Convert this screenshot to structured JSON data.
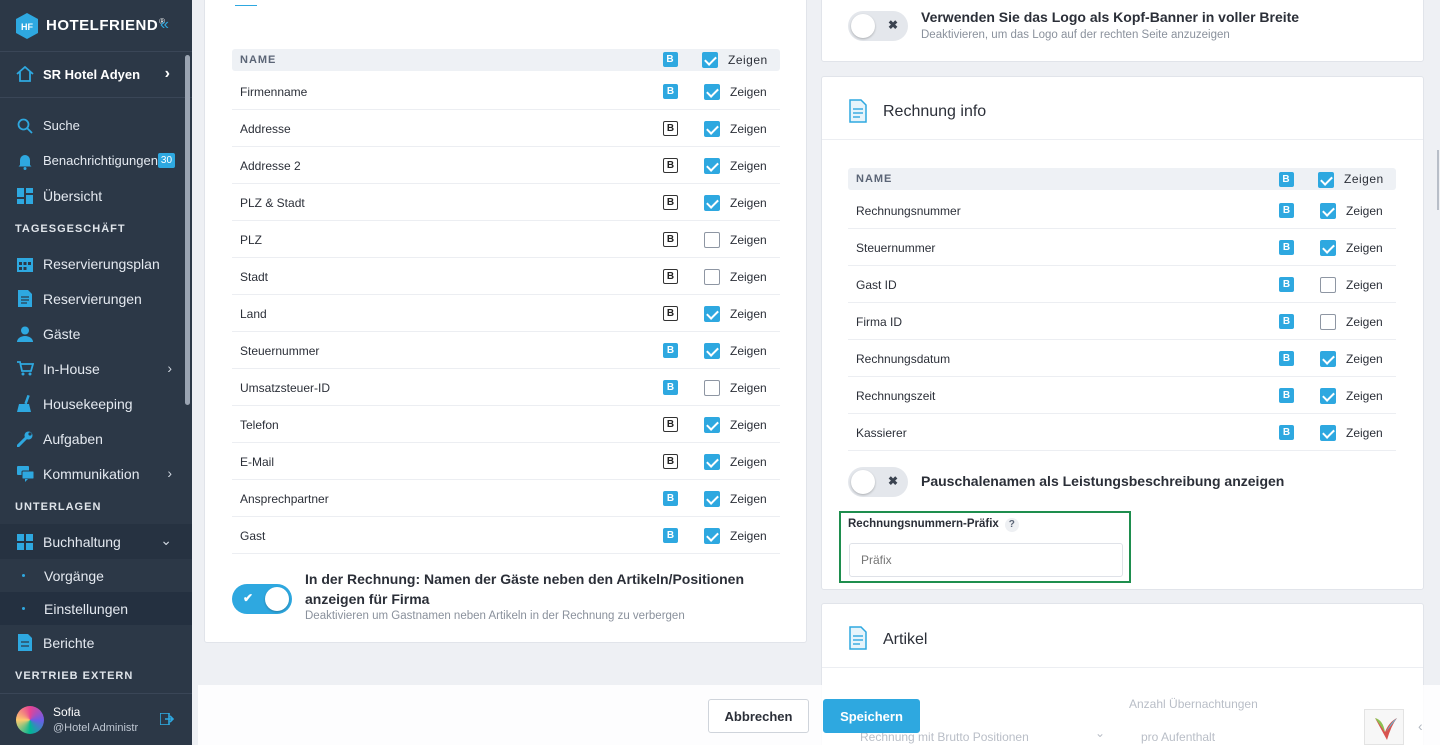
{
  "sidebar": {
    "brand": "HOTELFRIEND",
    "brand_mark": "®",
    "collapse_icon": "«",
    "hotel": "SR Hotel Adyen",
    "search": "Suche",
    "notifications": "Benachrichtigungen",
    "notifications_count": "30",
    "overview": "Übersicht",
    "section_daily": "TAGESGESCHÄFT",
    "reservation_plan": "Reservierungsplan",
    "reservations": "Reservierungen",
    "guests": "Gäste",
    "in_house": "In-House",
    "housekeeping": "Housekeeping",
    "tasks": "Aufgaben",
    "communication": "Kommunikation",
    "section_docs": "UNTERLAGEN",
    "accounting": "Buchhaltung",
    "transactions": "Vorgänge",
    "settings": "Einstellungen",
    "reports": "Berichte",
    "section_sales": "VERTRIEB EXTERN",
    "user_name": "Sofia",
    "user_role": "@Hotel Administr"
  },
  "company": {
    "header_name": "NAME",
    "header_show": "Zeigen",
    "bold_letter": "B",
    "rows": [
      {
        "label": "Firmenname",
        "bold": true,
        "show": true,
        "show_label": "Zeigen"
      },
      {
        "label": "Addresse",
        "bold": false,
        "show": true,
        "show_label": "Zeigen"
      },
      {
        "label": "Addresse 2",
        "bold": false,
        "show": true,
        "show_label": "Zeigen"
      },
      {
        "label": "PLZ & Stadt",
        "bold": false,
        "show": true,
        "show_label": "Zeigen"
      },
      {
        "label": "PLZ",
        "bold": false,
        "show": false,
        "show_label": "Zeigen"
      },
      {
        "label": "Stadt",
        "bold": false,
        "show": false,
        "show_label": "Zeigen"
      },
      {
        "label": "Land",
        "bold": false,
        "show": true,
        "show_label": "Zeigen"
      },
      {
        "label": "Steuernummer",
        "bold": true,
        "show": true,
        "show_label": "Zeigen"
      },
      {
        "label": "Umsatzsteuer-ID",
        "bold": true,
        "show": false,
        "show_label": "Zeigen"
      },
      {
        "label": "Telefon",
        "bold": false,
        "show": true,
        "show_label": "Zeigen"
      },
      {
        "label": "E-Mail",
        "bold": false,
        "show": true,
        "show_label": "Zeigen"
      },
      {
        "label": "Ansprechpartner",
        "bold": true,
        "show": true,
        "show_label": "Zeigen"
      },
      {
        "label": "Gast",
        "bold": true,
        "show": true,
        "show_label": "Zeigen"
      }
    ],
    "guest_toggle_title_1": "In der Rechnung: Namen der Gäste neben den Artikeln/Positionen",
    "guest_toggle_title_2": "anzeigen für Firma",
    "guest_toggle_sub": "Deaktivieren um Gastnamen neben Artikeln in der Rechnung zu verbergen"
  },
  "logo_banner": {
    "title": "Verwenden Sie das Logo als Kopf-Banner in voller Breite",
    "sub": "Deaktivieren, um das Logo auf der rechten Seite anzuzeigen"
  },
  "invoice": {
    "title": "Rechnung info",
    "header_name": "NAME",
    "header_show": "Zeigen",
    "bold_letter": "B",
    "rows": [
      {
        "label": "Rechnungsnummer",
        "bold": true,
        "show": true,
        "show_label": "Zeigen"
      },
      {
        "label": "Steuernummer",
        "bold": true,
        "show": true,
        "show_label": "Zeigen"
      },
      {
        "label": "Gast ID",
        "bold": true,
        "show": false,
        "show_label": "Zeigen"
      },
      {
        "label": "Firma ID",
        "bold": true,
        "show": false,
        "show_label": "Zeigen"
      },
      {
        "label": "Rechnungsdatum",
        "bold": true,
        "show": true,
        "show_label": "Zeigen"
      },
      {
        "label": "Rechnungszeit",
        "bold": true,
        "show": true,
        "show_label": "Zeigen"
      },
      {
        "label": "Kassierer",
        "bold": true,
        "show": true,
        "show_label": "Zeigen"
      }
    ],
    "package_toggle": "Pauschalenamen als Leistungsbeschreibung anzeigen",
    "prefix_label": "Rechnungsnummern-Präfix",
    "prefix_help": "?",
    "prefix_placeholder": "Präfix"
  },
  "articles": {
    "title": "Artikel",
    "nights_label": "Anzahl Übernachtungen",
    "type_value": "Rechnung mit Brutto Positionen",
    "nights_value": "pro Aufenthalt"
  },
  "footer": {
    "cancel": "Abbrechen",
    "save": "Speichern"
  },
  "colors": {
    "accent": "#2ea8e0",
    "sidebar": "#2c3847",
    "focus_border": "#1e8e4e"
  }
}
